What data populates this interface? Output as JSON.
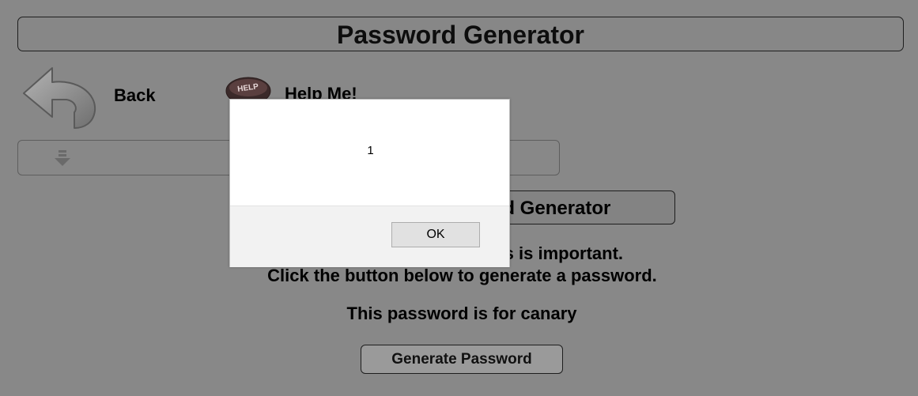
{
  "header": {
    "title": "Password Generator"
  },
  "nav": {
    "back_label": "Back",
    "help_label": "Help Me!",
    "help_icon_text": "HELP"
  },
  "section": {
    "header_title": "Password Generator",
    "instructions": [
      "Having strong passwords is important.",
      "Click the button below to generate a password."
    ],
    "for_text": "This password is for canary",
    "generate_button_label": "Generate Password"
  },
  "dialog": {
    "message": "1",
    "ok_label": "OK"
  },
  "colors": {
    "page_background": "#888888",
    "dialog_background": "#ffffff",
    "dialog_footer": "#f2f2f2"
  }
}
